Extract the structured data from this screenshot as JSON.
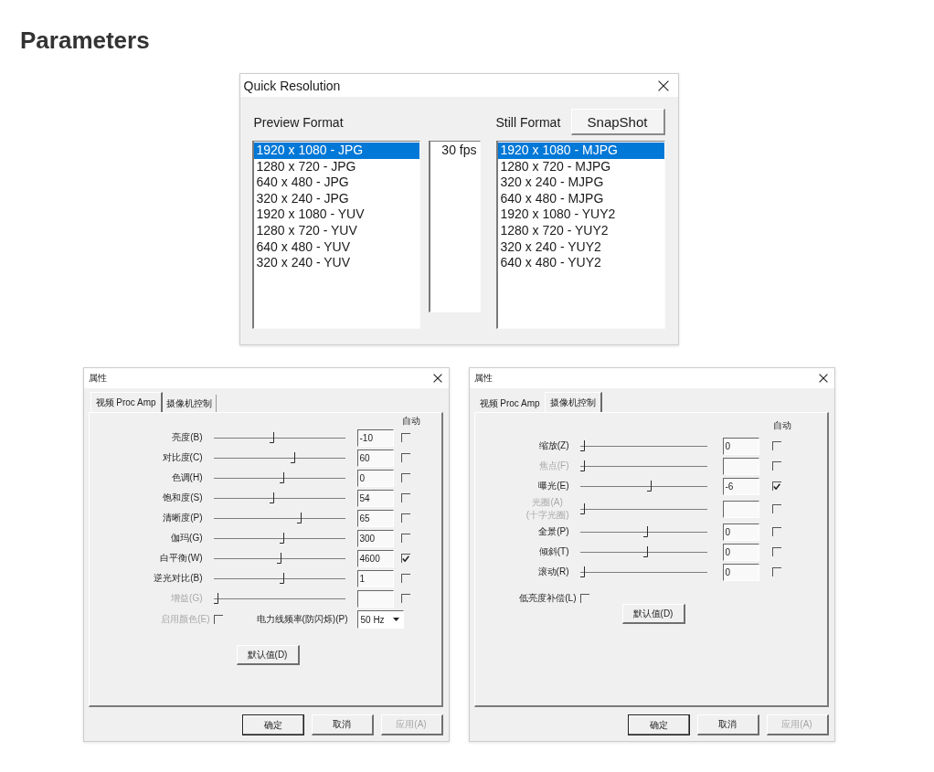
{
  "heading": "Parameters",
  "quick_resolution": {
    "title": "Quick Resolution",
    "preview_label": "Preview Format",
    "still_label": "Still Format",
    "snapshot_button": "SnapShot",
    "preview_formats": [
      {
        "label": "1920 x 1080 - JPG",
        "selected": true
      },
      {
        "label": "1280 x 720 - JPG",
        "selected": false
      },
      {
        "label": "640 x 480 - JPG",
        "selected": false
      },
      {
        "label": "320 x 240 - JPG",
        "selected": false
      },
      {
        "label": "1920 x 1080 - YUV",
        "selected": false
      },
      {
        "label": "1280 x 720 - YUV",
        "selected": false
      },
      {
        "label": "640 x 480 - YUV",
        "selected": false
      },
      {
        "label": "320 x 240 - YUV",
        "selected": false
      }
    ],
    "frame_rates": [
      {
        "label": "30 fps",
        "selected": false
      }
    ],
    "still_formats": [
      {
        "label": "1920 x 1080 - MJPG",
        "selected": true
      },
      {
        "label": "1280 x 720 - MJPG",
        "selected": false
      },
      {
        "label": "320 x 240 - MJPG",
        "selected": false
      },
      {
        "label": "640 x 480 - MJPG",
        "selected": false
      },
      {
        "label": "1920 x 1080 - YUY2",
        "selected": false
      },
      {
        "label": "1280 x 720 - YUY2",
        "selected": false
      },
      {
        "label": "320 x 240 - YUY2",
        "selected": false
      },
      {
        "label": "640 x 480 - YUY2",
        "selected": false
      }
    ]
  },
  "property_dialogs": [
    {
      "title": "属性",
      "tabs": [
        {
          "label": "视频 Proc Amp",
          "selected": true
        },
        {
          "label": "摄像机控制",
          "selected": false
        }
      ],
      "auto_header": "自动",
      "controls": [
        {
          "label": "亮度(B)",
          "disabled": false,
          "level": 0.44,
          "value": "-10",
          "auto": false
        },
        {
          "label": "对比度(C)",
          "disabled": false,
          "level": 0.61,
          "value": "60",
          "auto": false
        },
        {
          "label": "色调(H)",
          "disabled": false,
          "level": 0.52,
          "value": "0",
          "auto": false
        },
        {
          "label": "饱和度(S)",
          "disabled": false,
          "level": 0.44,
          "value": "54",
          "auto": false
        },
        {
          "label": "清晰度(P)",
          "disabled": false,
          "level": 0.66,
          "value": "65",
          "auto": false
        },
        {
          "label": "伽玛(G)",
          "disabled": false,
          "level": 0.52,
          "value": "300",
          "auto": false
        },
        {
          "label": "白平衡(W)",
          "disabled": false,
          "level": 0.5,
          "value": "4600",
          "auto": true
        },
        {
          "label": "逆光对比(B)",
          "disabled": false,
          "level": 0.52,
          "value": "1",
          "auto": false
        },
        {
          "label": "增益(G)",
          "disabled": true,
          "level": 0,
          "auto": false
        }
      ],
      "extras": [
        {
          "kind": "checkbox",
          "label": "启用颜色(E)",
          "disabled": true,
          "checked": false
        },
        {
          "kind": "dropdown",
          "label": "电力线频率(防闪烁)(P)",
          "value": "50 Hz"
        }
      ],
      "default_button": "默认值(D)",
      "buttons": [
        {
          "label": "确定",
          "default": true,
          "disabled": false
        },
        {
          "label": "取消",
          "default": false,
          "disabled": false
        },
        {
          "label": "应用(A)",
          "default": false,
          "disabled": true
        }
      ]
    },
    {
      "title": "属性",
      "tabs": [
        {
          "label": "视频 Proc Amp",
          "selected": false
        },
        {
          "label": "摄像机控制",
          "selected": true
        }
      ],
      "auto_header": "自动",
      "controls": [
        {
          "label": "缩放(Z)",
          "disabled": false,
          "level": 0,
          "value": "0",
          "auto": false
        },
        {
          "label": "焦点(F)",
          "disabled": true,
          "level": 0,
          "auto": false
        },
        {
          "label": "曝光(E)",
          "disabled": false,
          "level": 0.55,
          "value": "-6",
          "auto": true
        },
        {
          "label": "光圈(A)",
          "sublabel": "(十字光圈)",
          "disabled": true,
          "level": 0,
          "auto": false
        },
        {
          "label": "全景(P)",
          "disabled": false,
          "level": 0.52,
          "value": "0",
          "auto": false
        },
        {
          "label": "倾斜(T)",
          "disabled": false,
          "level": 0.52,
          "value": "0",
          "auto": false
        },
        {
          "label": "滚动(R)",
          "disabled": false,
          "level": 0,
          "value": "0",
          "auto": false
        }
      ],
      "extras": [
        {
          "kind": "checkbox",
          "label": "低亮度补偿(L)",
          "disabled": false,
          "checked": false
        }
      ],
      "default_button": "默认值(D)",
      "buttons": [
        {
          "label": "确定",
          "default": true,
          "disabled": false
        },
        {
          "label": "取消",
          "default": false,
          "disabled": false
        },
        {
          "label": "应用(A)",
          "default": false,
          "disabled": true
        }
      ]
    }
  ]
}
